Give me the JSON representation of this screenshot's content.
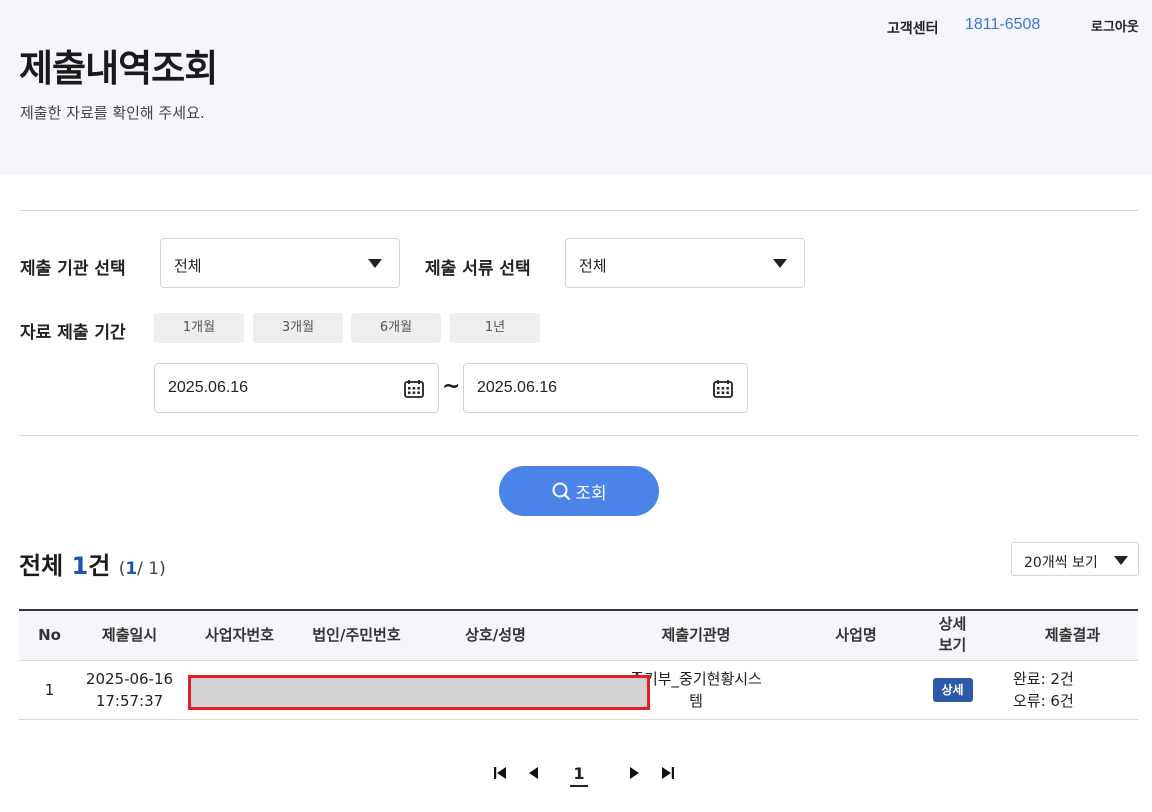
{
  "header": {
    "title": "제출내역조회",
    "subtitle": "제출한 자료를 확인해 주세요.",
    "cs_label": "고객센터",
    "cs_phone": "1811-6508",
    "logout": "로그아웃"
  },
  "filters": {
    "agency_label": "제출 기관 선택",
    "agency_value": "전체",
    "doc_label": "제출 서류 선택",
    "doc_value": "전체",
    "period_label": "자료 제출 기간",
    "period_buttons": [
      "1개월",
      "3개월",
      "6개월",
      "1년"
    ],
    "date_from": "2025.06.16",
    "date_sep": "~",
    "date_to": "2025.06.16"
  },
  "search_button": "조회",
  "summary": {
    "prefix": "전체",
    "count": "1",
    "suffix": "건",
    "page_open": "(",
    "current_page": "1",
    "page_rest": "/ 1)"
  },
  "per_page": "20개씩 보기",
  "table": {
    "headers": [
      "No",
      "제출일시",
      "사업자번호",
      "법인/주민번호",
      "상호/성명",
      "제출기관명",
      "사업명",
      "상세\n보기",
      "제출결과"
    ],
    "rows": [
      {
        "no": "1",
        "date": "2025-06-16",
        "time": "17:57:37",
        "agency_line1": "중기부_중기현황시스",
        "agency_line2": "템",
        "detail": "상세",
        "result_ok": "완료: 2건",
        "result_err": "오류: 6건"
      }
    ]
  },
  "pagination": {
    "current": "1",
    "icons": [
      "first-page-icon",
      "prev-page-icon",
      "next-page-icon",
      "last-page-icon"
    ]
  },
  "colors": {
    "accent": "#4b84e8",
    "phone": "#3a78d6",
    "badge": "#2c5aa8",
    "mask_border": "#e02020"
  }
}
